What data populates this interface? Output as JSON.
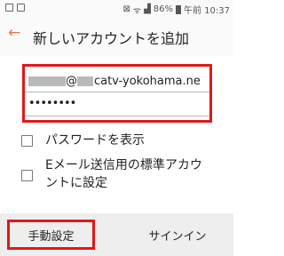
{
  "status_bar": {
    "battery": "86%",
    "time": "午前 10:37"
  },
  "header": {
    "back_icon": "arrow-left-icon",
    "title": "新しいアカウントを追加"
  },
  "form": {
    "email_local": "",
    "email_at": "@",
    "email_domain": "catv-yokohama.ne",
    "password": "••••••••"
  },
  "options": {
    "show_password": "パスワードを表示",
    "default_account_line1": "Eメール送信用の標準アカウ",
    "default_account_line2": "ントに設定"
  },
  "bottom": {
    "manual_label": "手動設定",
    "signin_label": "サインイン"
  },
  "colors": {
    "accent": "#e8764b",
    "highlight": "#e01818"
  }
}
